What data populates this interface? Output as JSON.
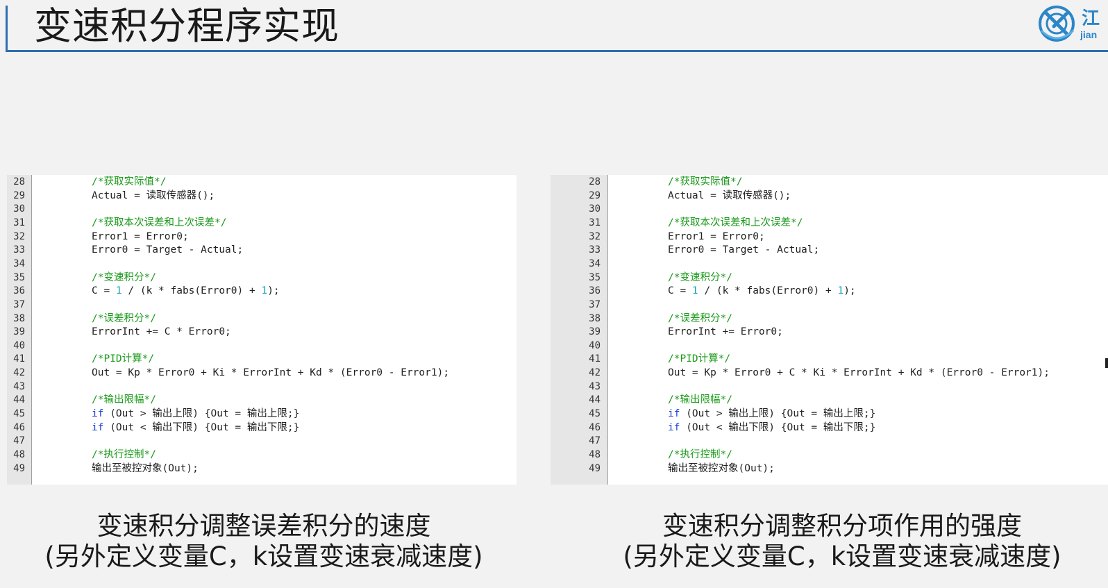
{
  "title": "变速积分程序实现",
  "logo": {
    "text_main": "江",
    "text_sub": "jian"
  },
  "colors": {
    "accent": "#2e6db4",
    "comment": "#1a9a1a",
    "keyword": "#1a3fd6",
    "number": "#17a2b8"
  },
  "left_panel": {
    "lines": [
      {
        "n": "28",
        "code": "/*获取实际值*/"
      },
      {
        "n": "29",
        "code": "Actual = 读取传感器();"
      },
      {
        "n": "30",
        "code": ""
      },
      {
        "n": "31",
        "code": "/*获取本次误差和上次误差*/"
      },
      {
        "n": "32",
        "code": "Error1 = Error0;"
      },
      {
        "n": "33",
        "code": "Error0 = Target - Actual;"
      },
      {
        "n": "34",
        "code": ""
      },
      {
        "n": "35",
        "code": "/*变速积分*/"
      },
      {
        "n": "36",
        "code": "C = 1 / (k * fabs(Error0) + 1);"
      },
      {
        "n": "37",
        "code": ""
      },
      {
        "n": "38",
        "code": "/*误差积分*/"
      },
      {
        "n": "39",
        "code": "ErrorInt += C * Error0;"
      },
      {
        "n": "40",
        "code": ""
      },
      {
        "n": "41",
        "code": "/*PID计算*/"
      },
      {
        "n": "42",
        "code": "Out = Kp * Error0 + Ki * ErrorInt + Kd * (Error0 - Error1);"
      },
      {
        "n": "43",
        "code": ""
      },
      {
        "n": "44",
        "code": "/*输出限幅*/"
      },
      {
        "n": "45",
        "code": "if (Out > 输出上限) {Out = 输出上限;}"
      },
      {
        "n": "46",
        "code": "if (Out < 输出下限) {Out = 输出下限;}"
      },
      {
        "n": "47",
        "code": ""
      },
      {
        "n": "48",
        "code": "/*执行控制*/"
      },
      {
        "n": "49",
        "code": "输出至被控对象(Out);"
      }
    ]
  },
  "right_panel": {
    "lines": [
      {
        "n": "28",
        "code": "/*获取实际值*/"
      },
      {
        "n": "29",
        "code": "Actual = 读取传感器();"
      },
      {
        "n": "30",
        "code": ""
      },
      {
        "n": "31",
        "code": "/*获取本次误差和上次误差*/"
      },
      {
        "n": "32",
        "code": "Error1 = Error0;"
      },
      {
        "n": "33",
        "code": "Error0 = Target - Actual;"
      },
      {
        "n": "34",
        "code": ""
      },
      {
        "n": "35",
        "code": "/*变速积分*/"
      },
      {
        "n": "36",
        "code": "C = 1 / (k * fabs(Error0) + 1);"
      },
      {
        "n": "37",
        "code": ""
      },
      {
        "n": "38",
        "code": "/*误差积分*/"
      },
      {
        "n": "39",
        "code": "ErrorInt += Error0;"
      },
      {
        "n": "40",
        "code": ""
      },
      {
        "n": "41",
        "code": "/*PID计算*/"
      },
      {
        "n": "42",
        "code": "Out = Kp * Error0 + C * Ki * ErrorInt + Kd * (Error0 - Error1);"
      },
      {
        "n": "43",
        "code": ""
      },
      {
        "n": "44",
        "code": "/*输出限幅*/"
      },
      {
        "n": "45",
        "code": "if (Out > 输出上限) {Out = 输出上限;}"
      },
      {
        "n": "46",
        "code": "if (Out < 输出下限) {Out = 输出下限;}"
      },
      {
        "n": "47",
        "code": ""
      },
      {
        "n": "48",
        "code": "/*执行控制*/"
      },
      {
        "n": "49",
        "code": "输出至被控对象(Out);"
      }
    ]
  },
  "captions": {
    "left_line1": "变速积分调整误差积分的速度",
    "left_line2": "(另外定义变量C，k设置变速衰减速度)",
    "right_line1": "变速积分调整积分项作用的强度",
    "right_line2": "(另外定义变量C，k设置变速衰减速度)"
  }
}
